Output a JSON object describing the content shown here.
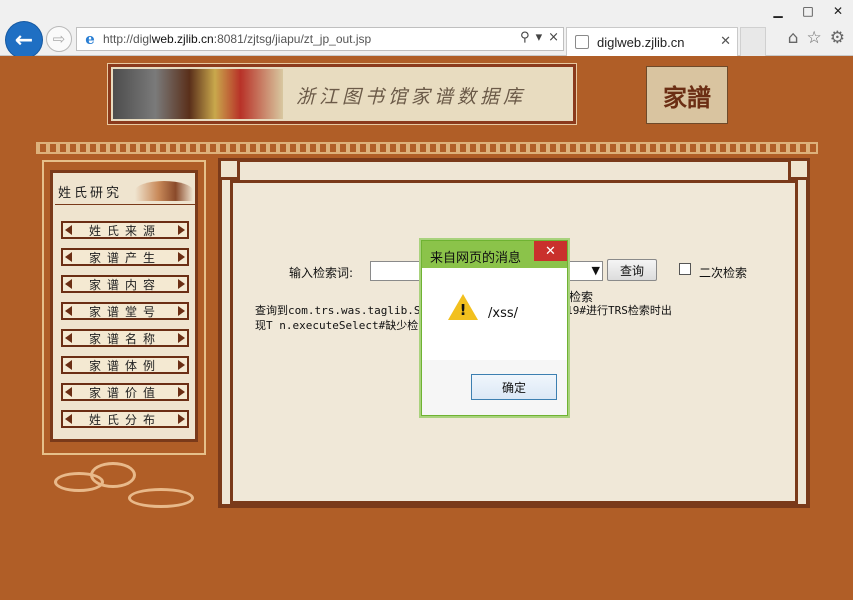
{
  "browser": {
    "url_prefix": "http://digl",
    "url_host": "web.zjlib.cn",
    "url_rest": ":8081/zjtsg/jiapu/zt_jp_out.jsp",
    "tab_title": "diglweb.zjlib.cn",
    "back_glyph": "←",
    "forward_glyph": "⇨",
    "minimize_glyph": "▁",
    "maximize_glyph": "□",
    "close_glyph": "✕",
    "search_glyph": "⚲",
    "refresh_glyph": "×",
    "home_glyph": "⌂",
    "favorites_glyph": "☆",
    "settings_glyph": "⚙"
  },
  "banner": {
    "title": "浙江图书馆家谱数据库",
    "logo_text": "家譜"
  },
  "sidebar": {
    "title": "姓氏研究",
    "items": [
      {
        "label": "姓氏来源"
      },
      {
        "label": "家谱产生"
      },
      {
        "label": "家谱内容"
      },
      {
        "label": "家谱堂号"
      },
      {
        "label": "家谱名称"
      },
      {
        "label": "家谱体例"
      },
      {
        "label": "家谱价值"
      },
      {
        "label": "姓氏分布"
      }
    ]
  },
  "search": {
    "label": "输入检索词:",
    "input_value": "",
    "query_button": "查询",
    "secondary_label": "二次检索",
    "partial_text": "检索",
    "error_line1": "查询到com.trs.was.taglib.Sear                              t WASException:21019#进行TRS检索时出",
    "error_line2": "现T                                   n.executeSelect#缺少检索词(SERVER@1$"
  },
  "dialog": {
    "title": "来自网页的消息",
    "close_glyph": "✕",
    "message": "/xss/",
    "warning_glyph": "!",
    "ok_button": "确定"
  },
  "colors": {
    "page_background": "#b05e27",
    "panel_border": "#7a3a1a",
    "dialog_titlebar": "#8bc34a",
    "dialog_close": "#c9302c"
  }
}
